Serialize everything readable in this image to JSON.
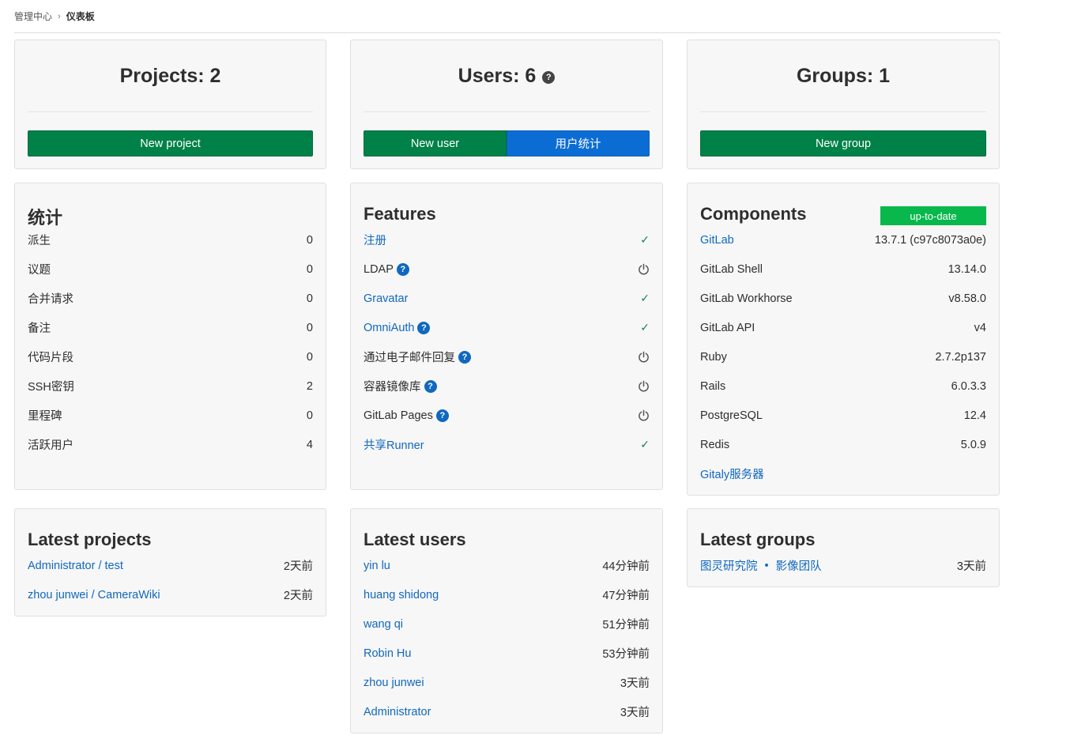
{
  "breadcrumb": {
    "parent": "管理中心",
    "current": "仪表板"
  },
  "projects": {
    "title": "Projects: 2",
    "new_button": "New project"
  },
  "users": {
    "title": "Users: 6",
    "new_button": "New user",
    "stats_button": "用户统计"
  },
  "groups": {
    "title": "Groups: 1",
    "new_button": "New group"
  },
  "statistics": {
    "title": "统计",
    "rows": [
      {
        "label": "派生",
        "value": "0"
      },
      {
        "label": "议题",
        "value": "0"
      },
      {
        "label": "合并请求",
        "value": "0"
      },
      {
        "label": "备注",
        "value": "0"
      },
      {
        "label": "代码片段",
        "value": "0"
      },
      {
        "label": "SSH密钥",
        "value": "2"
      },
      {
        "label": "里程碑",
        "value": "0"
      },
      {
        "label": "活跃用户",
        "value": "4"
      }
    ]
  },
  "features": {
    "title": "Features",
    "rows": [
      {
        "label": "注册",
        "status": "enabled"
      },
      {
        "label": "LDAP",
        "status": "disabled"
      },
      {
        "label": "Gravatar",
        "status": "enabled"
      },
      {
        "label": "OmniAuth",
        "status": "enabled"
      },
      {
        "label": "通过电子邮件回复",
        "status": "disabled"
      },
      {
        "label": "容器镜像库",
        "status": "disabled"
      },
      {
        "label": "GitLab Pages",
        "status": "disabled"
      },
      {
        "label": "共享Runner",
        "status": "enabled"
      }
    ]
  },
  "components": {
    "title": "Components",
    "badge": "up-to-date",
    "rows": [
      {
        "label": "GitLab",
        "value": "13.7.1 (c97c8073a0e)"
      },
      {
        "label": "GitLab Shell",
        "value": "13.14.0"
      },
      {
        "label": "GitLab Workhorse",
        "value": "v8.58.0"
      },
      {
        "label": "GitLab API",
        "value": "v4"
      },
      {
        "label": "Ruby",
        "value": "2.7.2p137"
      },
      {
        "label": "Rails",
        "value": "6.0.3.3"
      },
      {
        "label": "PostgreSQL",
        "value": "12.4"
      },
      {
        "label": "Redis",
        "value": "5.0.9"
      },
      {
        "label": "Gitaly服务器",
        "value": ""
      }
    ]
  },
  "latest_projects": {
    "title": "Latest projects",
    "rows": [
      {
        "name": "Administrator / test",
        "time": "2天前"
      },
      {
        "name": "zhou junwei / CameraWiki",
        "time": "2天前"
      }
    ]
  },
  "latest_users": {
    "title": "Latest users",
    "rows": [
      {
        "name": "yin lu",
        "time": "44分钟前"
      },
      {
        "name": "huang shidong",
        "time": "47分钟前"
      },
      {
        "name": "wang qi",
        "time": "51分钟前"
      },
      {
        "name": "Robin Hu",
        "time": "53分钟前"
      },
      {
        "name": "zhou junwei",
        "time": "3天前"
      },
      {
        "name": "Administrator",
        "time": "3天前"
      }
    ]
  },
  "latest_groups": {
    "title": "Latest groups",
    "rows": [
      {
        "parent": "图灵研究院",
        "name": "影像团队",
        "time": "3天前"
      }
    ]
  },
  "colors": {
    "green": "#008148",
    "blue": "#0b6dd4",
    "link": "#1068bf",
    "badge": "#09b84c"
  }
}
